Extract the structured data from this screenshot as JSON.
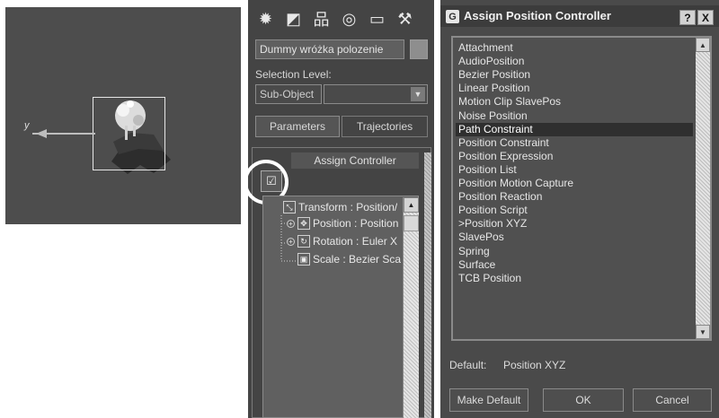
{
  "viewport": {
    "axis_label": "y"
  },
  "command_panel": {
    "tabs": [
      {
        "icon": "create-icon",
        "glyph": "✹"
      },
      {
        "icon": "modify-icon",
        "glyph": "◩"
      },
      {
        "icon": "hierarchy-icon",
        "glyph": "品"
      },
      {
        "icon": "motion-icon",
        "glyph": "◎"
      },
      {
        "icon": "display-icon",
        "glyph": "▭"
      },
      {
        "icon": "utilities-icon",
        "glyph": "⚒"
      }
    ],
    "object_name": "Dummy wróżka polozenie",
    "selection_level_label": "Selection Level:",
    "sub_object": "Sub-Object",
    "parameters_button": "Parameters",
    "trajectories_button": "Trajectories",
    "rollout_title": "Assign Controller",
    "tree": [
      {
        "label": "Transform : Position/",
        "icon": "transform-icon",
        "glyph": "⤡"
      },
      {
        "label": "Position : Position",
        "icon": "position-icon",
        "glyph": "✥"
      },
      {
        "label": "Rotation : Euler X",
        "icon": "rotation-icon",
        "glyph": "↻"
      },
      {
        "label": "Scale : Bezier Sca",
        "icon": "scale-icon",
        "glyph": "▣"
      }
    ]
  },
  "dialog": {
    "title": "Assign Position Controller",
    "help_button": "?",
    "close_button": "X",
    "items": [
      "Attachment",
      "AudioPosition",
      "Bezier Position",
      "Linear Position",
      "Motion Clip SlavePos",
      "Noise Position",
      "Path Constraint",
      "Position Constraint",
      "Position Expression",
      "Position List",
      "Position Motion Capture",
      "Position Reaction",
      "Position Script",
      ">Position XYZ",
      "SlavePos",
      "Spring",
      "Surface",
      "TCB Position"
    ],
    "selected_item": "Path Constraint",
    "default_label": "Default:",
    "default_value": "Position XYZ",
    "make_default_button": "Make Default",
    "ok_button": "OK",
    "cancel_button": "Cancel"
  }
}
